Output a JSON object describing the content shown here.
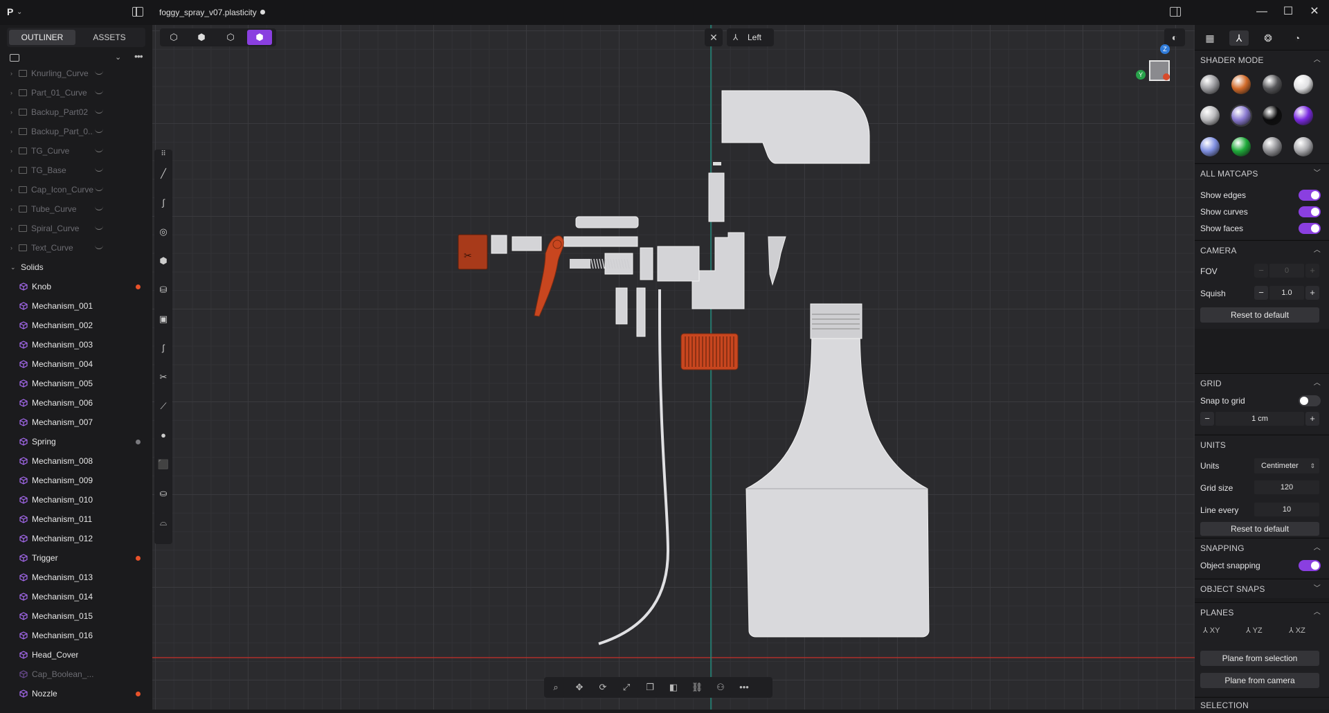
{
  "titlebar": {
    "app_logo": "P",
    "document_title": "foggy_spray_v07.plasticity"
  },
  "outliner": {
    "tabs": [
      {
        "label": "OUTLINER",
        "active": true
      },
      {
        "label": "ASSETS",
        "active": false
      }
    ],
    "curve_groups": [
      "Knurling_Curve",
      "Part_01_Curve",
      "Backup_Part02",
      "Backup_Part_0...",
      "TG_Curve",
      "TG_Base",
      "Cap_Icon_Curve",
      "Tube_Curve",
      "Spiral_Curve",
      "Text_Curve"
    ],
    "solids_label": "Solids",
    "solids": [
      {
        "name": "Knob",
        "dot": "#e8522a",
        "dim": false
      },
      {
        "name": "Mechanism_001",
        "dot": "",
        "dim": false
      },
      {
        "name": "Mechanism_002",
        "dot": "",
        "dim": false
      },
      {
        "name": "Mechanism_003",
        "dot": "",
        "dim": false
      },
      {
        "name": "Mechanism_004",
        "dot": "",
        "dim": false
      },
      {
        "name": "Mechanism_005",
        "dot": "",
        "dim": false
      },
      {
        "name": "Mechanism_006",
        "dot": "",
        "dim": false
      },
      {
        "name": "Mechanism_007",
        "dot": "",
        "dim": false
      },
      {
        "name": "Spring",
        "dot": "#7a7a7e",
        "dim": false
      },
      {
        "name": "Mechanism_008",
        "dot": "",
        "dim": false
      },
      {
        "name": "Mechanism_009",
        "dot": "",
        "dim": false
      },
      {
        "name": "Mechanism_010",
        "dot": "",
        "dim": false
      },
      {
        "name": "Mechanism_011",
        "dot": "",
        "dim": false
      },
      {
        "name": "Mechanism_012",
        "dot": "",
        "dim": false
      },
      {
        "name": "Trigger",
        "dot": "#e8522a",
        "dim": false
      },
      {
        "name": "Mechanism_013",
        "dot": "",
        "dim": false
      },
      {
        "name": "Mechanism_014",
        "dot": "",
        "dim": false
      },
      {
        "name": "Mechanism_015",
        "dot": "",
        "dim": false
      },
      {
        "name": "Mechanism_016",
        "dot": "",
        "dim": false
      },
      {
        "name": "Head_Cover",
        "dot": "",
        "dim": false
      },
      {
        "name": "Cap_Boolean_...",
        "dot": "",
        "dim": true
      },
      {
        "name": "Nozzle",
        "dot": "#e8522a",
        "dim": false
      }
    ]
  },
  "viewport": {
    "view_name": "Left",
    "gizmo": {
      "z": "Z",
      "y": "Y"
    },
    "colors": {
      "accent": "#8a3fe0",
      "highlight_part": "#c8461f",
      "x_axis": "#b0302a",
      "y_axis": "#1f8a7a"
    }
  },
  "panel": {
    "shader_mode": {
      "title": "SHADER MODE",
      "matcaps": [
        "#9a9a9e",
        "#d06a2a",
        "#555558",
        "#e0e0e2",
        "#b9b9bc",
        "#8a7ad0",
        "#0c0c0d",
        "#7a2ae0",
        "#7f8fe0",
        "#1faa3a",
        "#8e8e92",
        "#a9a9ad"
      ]
    },
    "all_matcaps": {
      "title": "ALL MATCAPS"
    },
    "display": [
      {
        "label": "Show edges",
        "on": true
      },
      {
        "label": "Show curves",
        "on": true
      },
      {
        "label": "Show faces",
        "on": true
      }
    ],
    "camera": {
      "title": "CAMERA",
      "fov_label": "FOV",
      "fov_value": "0",
      "squish_label": "Squish",
      "squish_value": "1.0",
      "reset_label": "Reset to default"
    },
    "grid": {
      "title": "GRID",
      "snap_label": "Snap to grid",
      "snap_on": false,
      "size_value": "1 cm"
    },
    "units": {
      "title": "UNITS",
      "units_label": "Units",
      "units_value": "Centimeter",
      "grid_size_label": "Grid size",
      "grid_size_value": "120",
      "line_every_label": "Line every",
      "line_every_value": "10",
      "reset_label": "Reset to default"
    },
    "snapping": {
      "title": "SNAPPING",
      "object_snapping_label": "Object snapping",
      "object_snapping_on": true
    },
    "object_snaps": {
      "title": "OBJECT SNAPS"
    },
    "planes": {
      "title": "PLANES",
      "options": [
        "XY",
        "YZ",
        "XZ"
      ],
      "from_selection": "Plane from selection",
      "from_camera": "Plane from camera"
    },
    "selection": {
      "title": "SELECTION"
    }
  }
}
